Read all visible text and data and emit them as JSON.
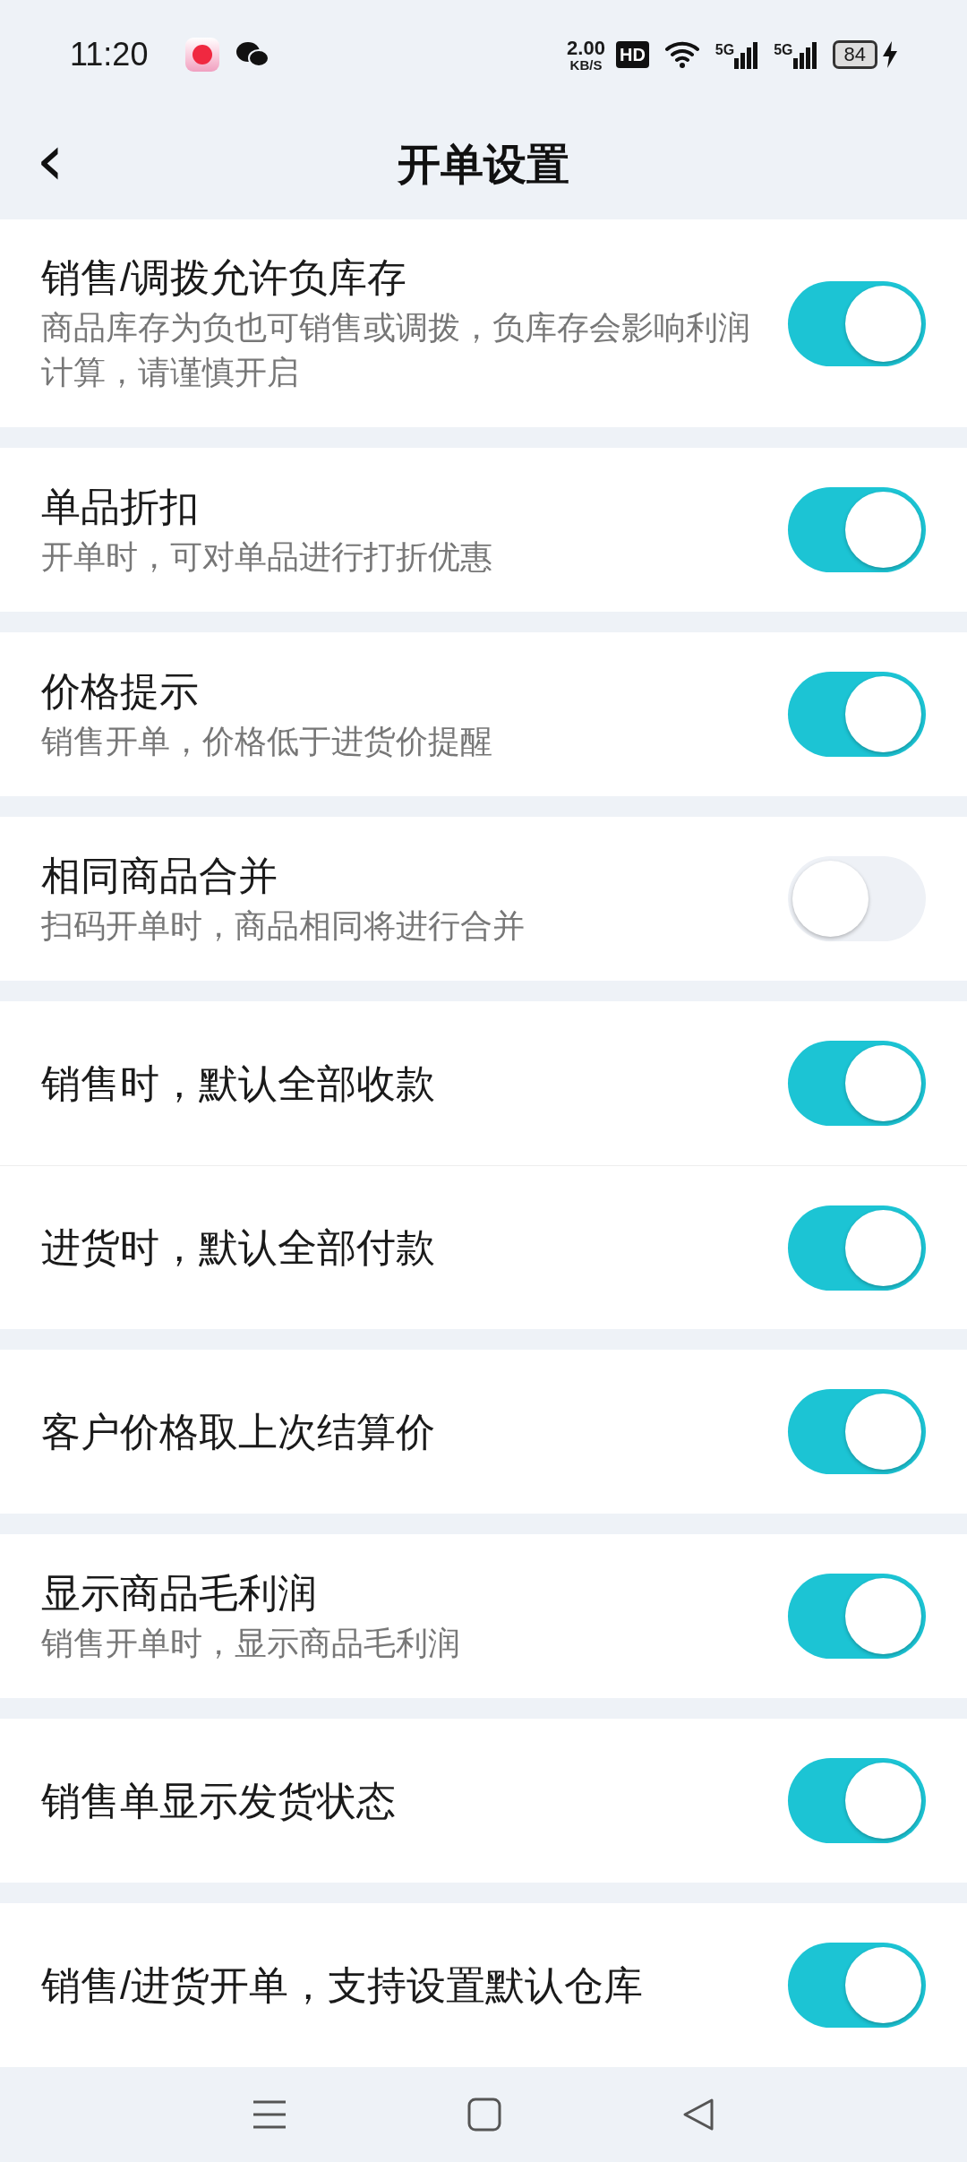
{
  "status_bar": {
    "time": "11:20",
    "speed_value": "2.00",
    "speed_unit": "KB/S",
    "hd": "HD",
    "network_1": "5G",
    "network_2": "5G",
    "battery": "84"
  },
  "header": {
    "back": "‹",
    "title": "开单设置"
  },
  "groups": [
    {
      "items": [
        {
          "title": "销售/调拨允许负库存",
          "subtitle": "商品库存为负也可销售或调拨，负库存会影响利润计算，请谨慎开启",
          "on": true
        }
      ]
    },
    {
      "items": [
        {
          "title": "单品折扣",
          "subtitle": "开单时，可对单品进行打折优惠",
          "on": true
        }
      ]
    },
    {
      "items": [
        {
          "title": "价格提示",
          "subtitle": "销售开单，价格低于进货价提醒",
          "on": true
        }
      ]
    },
    {
      "items": [
        {
          "title": "相同商品合并",
          "subtitle": "扫码开单时，商品相同将进行合并",
          "on": false
        }
      ]
    },
    {
      "items": [
        {
          "title": "销售时，默认全部收款",
          "on": true
        },
        {
          "title": "进货时，默认全部付款",
          "on": true
        }
      ]
    },
    {
      "items": [
        {
          "title": "客户价格取上次结算价",
          "on": true
        }
      ]
    },
    {
      "items": [
        {
          "title": "显示商品毛利润",
          "subtitle": "销售开单时，显示商品毛利润",
          "on": true
        }
      ]
    },
    {
      "items": [
        {
          "title": "销售单显示发货状态",
          "on": true
        }
      ]
    },
    {
      "items": [
        {
          "title": "销售/进货开单，支持设置默认仓库",
          "on": true
        }
      ]
    }
  ]
}
